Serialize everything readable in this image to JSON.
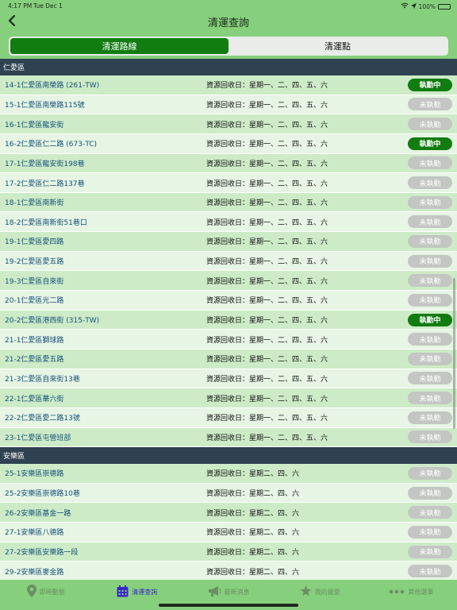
{
  "status_bar": {
    "time": "4:17 PM",
    "date": "Tue Dec 1",
    "battery": "100%"
  },
  "nav": {
    "title": "清運查詢"
  },
  "segments": [
    {
      "label": "清運路線",
      "active": true
    },
    {
      "label": "清運點",
      "active": false
    }
  ],
  "sections": [
    {
      "title": "仁愛區",
      "rows": [
        {
          "name": "14-1仁愛區南榮路 (261-TW)",
          "schedule": "資源回收日：星期一、二、四、五、六",
          "status": "執勤中",
          "active": true
        },
        {
          "name": "15-1仁愛區南榮路115號",
          "schedule": "資源回收日：星期一、二、四、五、六",
          "status": "未執勤",
          "active": false
        },
        {
          "name": "16-1仁愛區龍安街",
          "schedule": "資源回收日：星期一、二、四、五、六",
          "status": "未執勤",
          "active": false
        },
        {
          "name": "16-2仁愛區仁二路 (673-TC)",
          "schedule": "資源回收日：星期一、二、四、五、六",
          "status": "執勤中",
          "active": true
        },
        {
          "name": "17-1仁愛區龍安街198巷",
          "schedule": "資源回收日：星期一、二、四、五、六",
          "status": "未執勤",
          "active": false
        },
        {
          "name": "17-2仁愛區仁二路137巷",
          "schedule": "資源回收日：星期一、二、四、五、六",
          "status": "未執勤",
          "active": false
        },
        {
          "name": "18-1仁愛區南新街",
          "schedule": "資源回收日：星期一、二、四、五、六",
          "status": "未執勤",
          "active": false
        },
        {
          "name": "18-2仁愛區南新街51巷口",
          "schedule": "資源回收日：星期一、二、四、五、六",
          "status": "未執勤",
          "active": false
        },
        {
          "name": "19-1仁愛區愛四路",
          "schedule": "資源回收日：星期一、二、四、五、六",
          "status": "未執勤",
          "active": false
        },
        {
          "name": "19-2仁愛區愛五路",
          "schedule": "資源回收日：星期一、二、四、五、六",
          "status": "未執勤",
          "active": false
        },
        {
          "name": "19-3仁愛區自來街",
          "schedule": "資源回收日：星期一、二、四、五、六",
          "status": "未執勤",
          "active": false
        },
        {
          "name": "20-1仁愛區光二路",
          "schedule": "資源回收日：星期一、二、四、五、六",
          "status": "未執勤",
          "active": false
        },
        {
          "name": "20-2仁愛區港西街 (315-TW)",
          "schedule": "資源回收日：星期一、二、四、五、六",
          "status": "執勤中",
          "active": true
        },
        {
          "name": "21-1仁愛區獅球路",
          "schedule": "資源回收日：星期一、二、四、五、六",
          "status": "未執勤",
          "active": false
        },
        {
          "name": "21-2仁愛區愛五路",
          "schedule": "資源回收日：星期一、二、四、五、六",
          "status": "未執勤",
          "active": false
        },
        {
          "name": "21-3仁愛區自來街13巷",
          "schedule": "資源回收日：星期一、二、四、五、六",
          "status": "未執勤",
          "active": false
        },
        {
          "name": "22-1仁愛區華六街",
          "schedule": "資源回收日：星期一、二、四、五、六",
          "status": "未執勤",
          "active": false
        },
        {
          "name": "22-2仁愛區愛二路13號",
          "schedule": "資源回收日：星期一、二、四、五、六",
          "status": "未執勤",
          "active": false
        },
        {
          "name": "23-1仁愛區屯營班部",
          "schedule": "資源回收日：星期一、二、四、五、六",
          "status": "未執勤",
          "active": false
        }
      ]
    },
    {
      "title": "安樂區",
      "rows": [
        {
          "name": "25-1安樂區崇德路",
          "schedule": "資源回收日：星期二、四、六",
          "status": "未執勤",
          "active": false
        },
        {
          "name": "25-2安樂區崇德路10巷",
          "schedule": "資源回收日：星期二、四、六",
          "status": "未執勤",
          "active": false
        },
        {
          "name": "26-2安樂區基金一路",
          "schedule": "資源回收日：星期二、四、六",
          "status": "未執勤",
          "active": false
        },
        {
          "name": "27-1安樂區八德路",
          "schedule": "資源回收日：星期二、四、六",
          "status": "未執勤",
          "active": false
        },
        {
          "name": "27-2安樂區安樂路一段",
          "schedule": "資源回收日：星期二、四、六",
          "status": "未執勤",
          "active": false
        },
        {
          "name": "29-2安樂區麥金路",
          "schedule": "資源回收日：星期二、四、六",
          "status": "未執勤",
          "active": false
        }
      ]
    }
  ],
  "tabs": [
    {
      "label": "即時動態",
      "icon": "map-pin-icon",
      "active": false
    },
    {
      "label": "清運查詢",
      "icon": "calendar-icon",
      "active": true
    },
    {
      "label": "最新消息",
      "icon": "megaphone-icon",
      "active": false
    },
    {
      "label": "我的最愛",
      "icon": "star-icon",
      "active": false
    },
    {
      "label": "其他選單",
      "icon": "more-icon",
      "active": false
    }
  ],
  "colors": {
    "header_green": "#86cf7c",
    "active_green": "#117c10",
    "section_header": "#2f4252",
    "row_even": "#cdebc7",
    "row_odd": "#e7f5e4",
    "inactive_badge": "#c3c6c3",
    "route_text": "#15507a",
    "active_tab": "#3b27c9"
  }
}
